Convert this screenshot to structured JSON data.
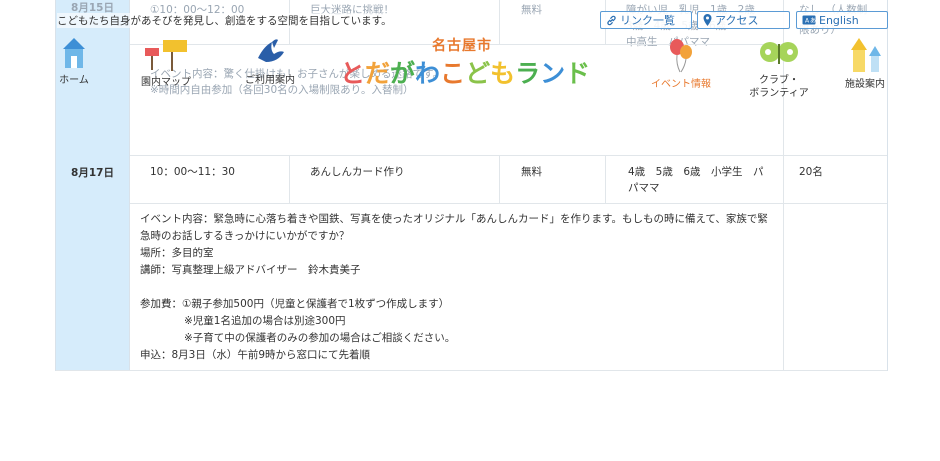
{
  "header": {
    "tagline": "こどもたち自身があそびを発見し、創造をする空間を目指しています。",
    "links": {
      "link_list": "リンク一覧",
      "access": "アクセス",
      "english": "English"
    },
    "logo": {
      "sub": "名古屋市",
      "main": [
        "と",
        "だ",
        "が",
        "わ",
        "こ",
        "ど",
        "も",
        "ラ",
        "ン",
        "ド"
      ],
      "colors": [
        "#e85a5a",
        "#f2a23a",
        "#4caf50",
        "#3d8fd6",
        "#e8792e",
        "#8bc34a",
        "#f2c12e",
        "#4caf50",
        "#3d8fd6",
        "#6abf4b"
      ]
    },
    "nav": [
      {
        "label": "ホーム"
      },
      {
        "label": "園内マップ"
      },
      {
        "label": "ご利用案内"
      },
      {
        "label": "イベント情報"
      },
      {
        "label": "クラブ・",
        "label2": "ボランティア"
      },
      {
        "label": "施設案内"
      }
    ]
  },
  "schedule": {
    "row_prev": {
      "date": "8月15日",
      "time": "①10：00～12：00",
      "title": "巨大迷路に挑戦！",
      "fee": "無料",
      "target": "障がい児　乳児　1歳　2歳",
      "target2": "3歳　4歳　5歳　6歳",
      "target3": "中高生　パパママ",
      "capacity": "なし　（人数制",
      "capacity2": "限あり）",
      "detail1": "イベント内容：驚く仕掛けも！お子さんが楽しめる迷路です。",
      "detail2": "※時間内自由参加（各回30名の入場制限あり。入替制）"
    },
    "row": {
      "date": "8月17日",
      "time": "10：00～11：30",
      "title": "あんしんカード作り",
      "fee": "無料",
      "target": "4歳　5歳　6歳　小学生　パ",
      "target2": "パママ",
      "capacity": "20名",
      "detail": {
        "line1": "イベント内容：緊急時に心落ち着きや国鉄、写真を使ったオリジナル「あんしんカード」を作ります。もしもの時に備えて、家族で緊",
        "line2": "急時のお話しするきっかけにいかがですか？",
        "place": "場所：多目的室",
        "lecturer": "講師：写真整理上級アドバイザー　鈴木貴美子",
        "fee1": "参加費：①親子参加500円（児童と保護者で1枚ずつ作成します）",
        "fee2": "※児童1名追加の場合は別途300円",
        "fee3": "※子育て中の保護者のみの参加の場合はご相談ください。",
        "apply": "申込：8月3日（水）午前9時から窓口にて先着順"
      }
    }
  }
}
